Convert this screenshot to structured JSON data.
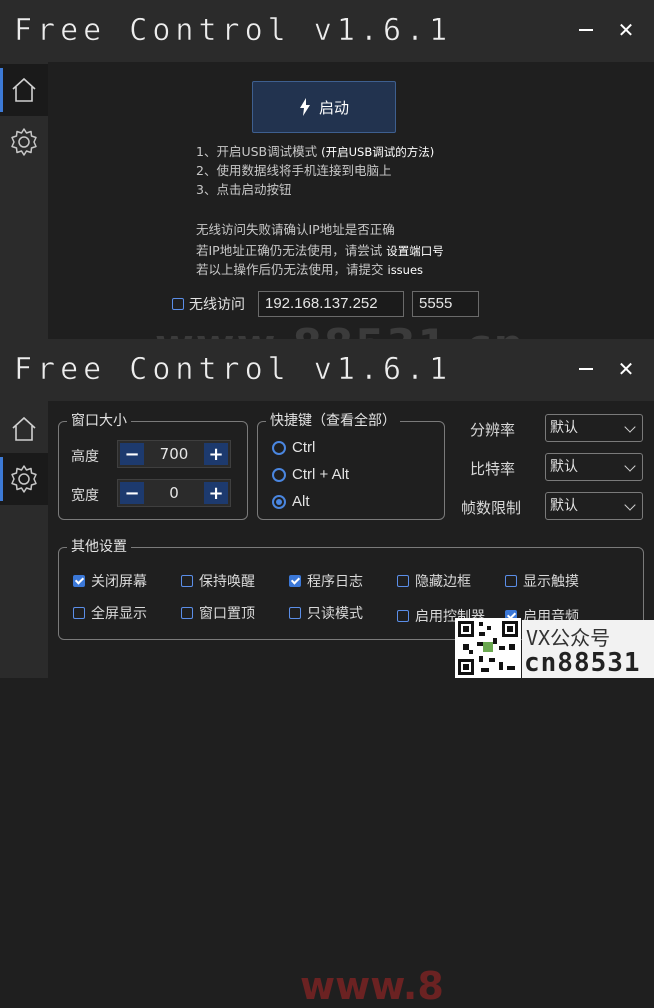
{
  "app_title": "Free Control v1.6.1",
  "window_controls": {
    "minimize": "minimize",
    "close": "✕"
  },
  "sidebar": {
    "items": [
      {
        "name": "home"
      },
      {
        "name": "settings"
      }
    ]
  },
  "home": {
    "start_button": "启动",
    "instructions": [
      "1、开启USB调试模式",
      "2、使用数据线将手机连接到电脑上",
      "3、点击启动按钮"
    ],
    "usb_help_link": "(开启USB调试的方法)",
    "notes": {
      "line1": "无线访问失败请确认IP地址是否正确",
      "line2": "若IP地址正确仍无法使用，请尝试",
      "line2_link": "设置端口号",
      "line3": "若以上操作后仍无法使用，请提交",
      "line3_link": "issues"
    },
    "wireless_label": "无线访问",
    "wireless_checked": false,
    "ip_value": "192.168.137.252",
    "port_value": "5555"
  },
  "settings": {
    "window_size": {
      "legend": "窗口大小",
      "height_label": "高度",
      "height_value": "700",
      "width_label": "宽度",
      "width_value": "0"
    },
    "hotkey": {
      "legend": "快捷键（查看全部）",
      "options": [
        "Ctrl",
        "Ctrl + Alt",
        "Alt"
      ],
      "selected": "Alt"
    },
    "selects": [
      {
        "label": "分辨率",
        "value": "默认"
      },
      {
        "label": "比特率",
        "value": "默认"
      },
      {
        "label": "帧数限制",
        "value": "默认"
      }
    ],
    "other": {
      "legend": "其他设置",
      "options": [
        {
          "label": "关闭屏幕",
          "checked": true
        },
        {
          "label": "保持唤醒",
          "checked": false
        },
        {
          "label": "程序日志",
          "checked": true
        },
        {
          "label": "隐藏边框",
          "checked": false
        },
        {
          "label": "显示触摸",
          "checked": false
        },
        {
          "label": "全屏显示",
          "checked": false
        },
        {
          "label": "窗口置顶",
          "checked": false
        },
        {
          "label": "只读模式",
          "checked": false
        },
        {
          "label": "启用控制器",
          "checked": false
        },
        {
          "label": "启用音频",
          "checked": true
        }
      ]
    }
  },
  "watermark": {
    "site": "www.88531.cn",
    "site_partial": "www.8",
    "brand_top": "VX公众号",
    "brand_bottom": "cn88531"
  },
  "colors": {
    "accent": "#3d7ad6",
    "titlebar": "#2b2b2b",
    "background": "#1f1f1f",
    "start_button": "#22334f"
  }
}
